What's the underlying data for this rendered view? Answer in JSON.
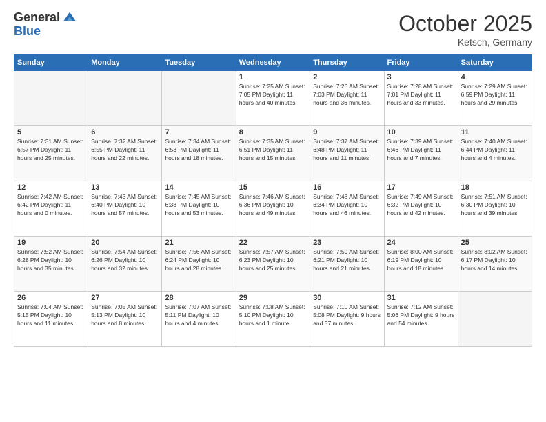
{
  "logo": {
    "general": "General",
    "blue": "Blue"
  },
  "header": {
    "month": "October 2025",
    "location": "Ketsch, Germany"
  },
  "weekdays": [
    "Sunday",
    "Monday",
    "Tuesday",
    "Wednesday",
    "Thursday",
    "Friday",
    "Saturday"
  ],
  "weeks": [
    [
      {
        "day": "",
        "info": ""
      },
      {
        "day": "",
        "info": ""
      },
      {
        "day": "",
        "info": ""
      },
      {
        "day": "1",
        "info": "Sunrise: 7:25 AM\nSunset: 7:05 PM\nDaylight: 11 hours\nand 40 minutes."
      },
      {
        "day": "2",
        "info": "Sunrise: 7:26 AM\nSunset: 7:03 PM\nDaylight: 11 hours\nand 36 minutes."
      },
      {
        "day": "3",
        "info": "Sunrise: 7:28 AM\nSunset: 7:01 PM\nDaylight: 11 hours\nand 33 minutes."
      },
      {
        "day": "4",
        "info": "Sunrise: 7:29 AM\nSunset: 6:59 PM\nDaylight: 11 hours\nand 29 minutes."
      }
    ],
    [
      {
        "day": "5",
        "info": "Sunrise: 7:31 AM\nSunset: 6:57 PM\nDaylight: 11 hours\nand 25 minutes."
      },
      {
        "day": "6",
        "info": "Sunrise: 7:32 AM\nSunset: 6:55 PM\nDaylight: 11 hours\nand 22 minutes."
      },
      {
        "day": "7",
        "info": "Sunrise: 7:34 AM\nSunset: 6:53 PM\nDaylight: 11 hours\nand 18 minutes."
      },
      {
        "day": "8",
        "info": "Sunrise: 7:35 AM\nSunset: 6:51 PM\nDaylight: 11 hours\nand 15 minutes."
      },
      {
        "day": "9",
        "info": "Sunrise: 7:37 AM\nSunset: 6:48 PM\nDaylight: 11 hours\nand 11 minutes."
      },
      {
        "day": "10",
        "info": "Sunrise: 7:39 AM\nSunset: 6:46 PM\nDaylight: 11 hours\nand 7 minutes."
      },
      {
        "day": "11",
        "info": "Sunrise: 7:40 AM\nSunset: 6:44 PM\nDaylight: 11 hours\nand 4 minutes."
      }
    ],
    [
      {
        "day": "12",
        "info": "Sunrise: 7:42 AM\nSunset: 6:42 PM\nDaylight: 11 hours\nand 0 minutes."
      },
      {
        "day": "13",
        "info": "Sunrise: 7:43 AM\nSunset: 6:40 PM\nDaylight: 10 hours\nand 57 minutes."
      },
      {
        "day": "14",
        "info": "Sunrise: 7:45 AM\nSunset: 6:38 PM\nDaylight: 10 hours\nand 53 minutes."
      },
      {
        "day": "15",
        "info": "Sunrise: 7:46 AM\nSunset: 6:36 PM\nDaylight: 10 hours\nand 49 minutes."
      },
      {
        "day": "16",
        "info": "Sunrise: 7:48 AM\nSunset: 6:34 PM\nDaylight: 10 hours\nand 46 minutes."
      },
      {
        "day": "17",
        "info": "Sunrise: 7:49 AM\nSunset: 6:32 PM\nDaylight: 10 hours\nand 42 minutes."
      },
      {
        "day": "18",
        "info": "Sunrise: 7:51 AM\nSunset: 6:30 PM\nDaylight: 10 hours\nand 39 minutes."
      }
    ],
    [
      {
        "day": "19",
        "info": "Sunrise: 7:52 AM\nSunset: 6:28 PM\nDaylight: 10 hours\nand 35 minutes."
      },
      {
        "day": "20",
        "info": "Sunrise: 7:54 AM\nSunset: 6:26 PM\nDaylight: 10 hours\nand 32 minutes."
      },
      {
        "day": "21",
        "info": "Sunrise: 7:56 AM\nSunset: 6:24 PM\nDaylight: 10 hours\nand 28 minutes."
      },
      {
        "day": "22",
        "info": "Sunrise: 7:57 AM\nSunset: 6:23 PM\nDaylight: 10 hours\nand 25 minutes."
      },
      {
        "day": "23",
        "info": "Sunrise: 7:59 AM\nSunset: 6:21 PM\nDaylight: 10 hours\nand 21 minutes."
      },
      {
        "day": "24",
        "info": "Sunrise: 8:00 AM\nSunset: 6:19 PM\nDaylight: 10 hours\nand 18 minutes."
      },
      {
        "day": "25",
        "info": "Sunrise: 8:02 AM\nSunset: 6:17 PM\nDaylight: 10 hours\nand 14 minutes."
      }
    ],
    [
      {
        "day": "26",
        "info": "Sunrise: 7:04 AM\nSunset: 5:15 PM\nDaylight: 10 hours\nand 11 minutes."
      },
      {
        "day": "27",
        "info": "Sunrise: 7:05 AM\nSunset: 5:13 PM\nDaylight: 10 hours\nand 8 minutes."
      },
      {
        "day": "28",
        "info": "Sunrise: 7:07 AM\nSunset: 5:11 PM\nDaylight: 10 hours\nand 4 minutes."
      },
      {
        "day": "29",
        "info": "Sunrise: 7:08 AM\nSunset: 5:10 PM\nDaylight: 10 hours\nand 1 minute."
      },
      {
        "day": "30",
        "info": "Sunrise: 7:10 AM\nSunset: 5:08 PM\nDaylight: 9 hours\nand 57 minutes."
      },
      {
        "day": "31",
        "info": "Sunrise: 7:12 AM\nSunset: 5:06 PM\nDaylight: 9 hours\nand 54 minutes."
      },
      {
        "day": "",
        "info": ""
      }
    ]
  ]
}
